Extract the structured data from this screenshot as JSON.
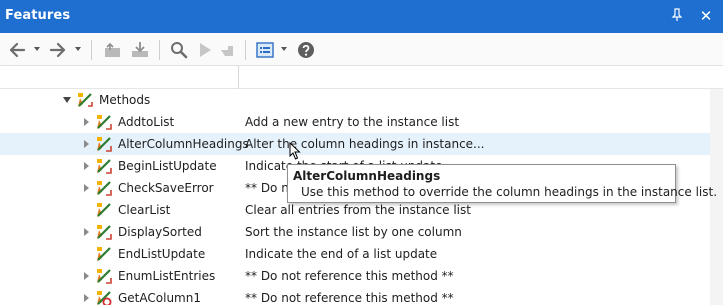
{
  "window": {
    "title": "Features"
  },
  "toolbar": {
    "icons": [
      "arrow-left-icon",
      "arrow-right-icon",
      "folder-up-icon",
      "download-icon",
      "search-icon",
      "play-icon",
      "hand-icon",
      "view-list-icon",
      "help-icon"
    ]
  },
  "tree": {
    "group_label": "Methods",
    "items": [
      {
        "name": "AddtoList",
        "description": "Add a new entry to the instance list"
      },
      {
        "name": "AlterColumnHeadings",
        "description": "Alter the column headings in instance..."
      },
      {
        "name": "BeginListUpdate",
        "description": "Indicate the start of a list update"
      },
      {
        "name": "CheckSaveError",
        "description": "** Do not reference this method **"
      },
      {
        "name": "ClearList",
        "description": "Clear all entries from the instance list"
      },
      {
        "name": "DisplaySorted",
        "description": "Sort the instance list by one column"
      },
      {
        "name": "EndListUpdate",
        "description": "Indicate the end of a list update"
      },
      {
        "name": "EnumListEntries",
        "description": "** Do not reference this method **"
      },
      {
        "name": "GetAColumn1",
        "description": "** Do not reference this method **"
      }
    ]
  },
  "tooltip": {
    "title": "AlterColumnHeadings",
    "body": "Use this method to override the column headings in the instance list."
  },
  "colors": {
    "titlebar": "#1f6fd0",
    "hover_row": "#e5f1fb"
  }
}
